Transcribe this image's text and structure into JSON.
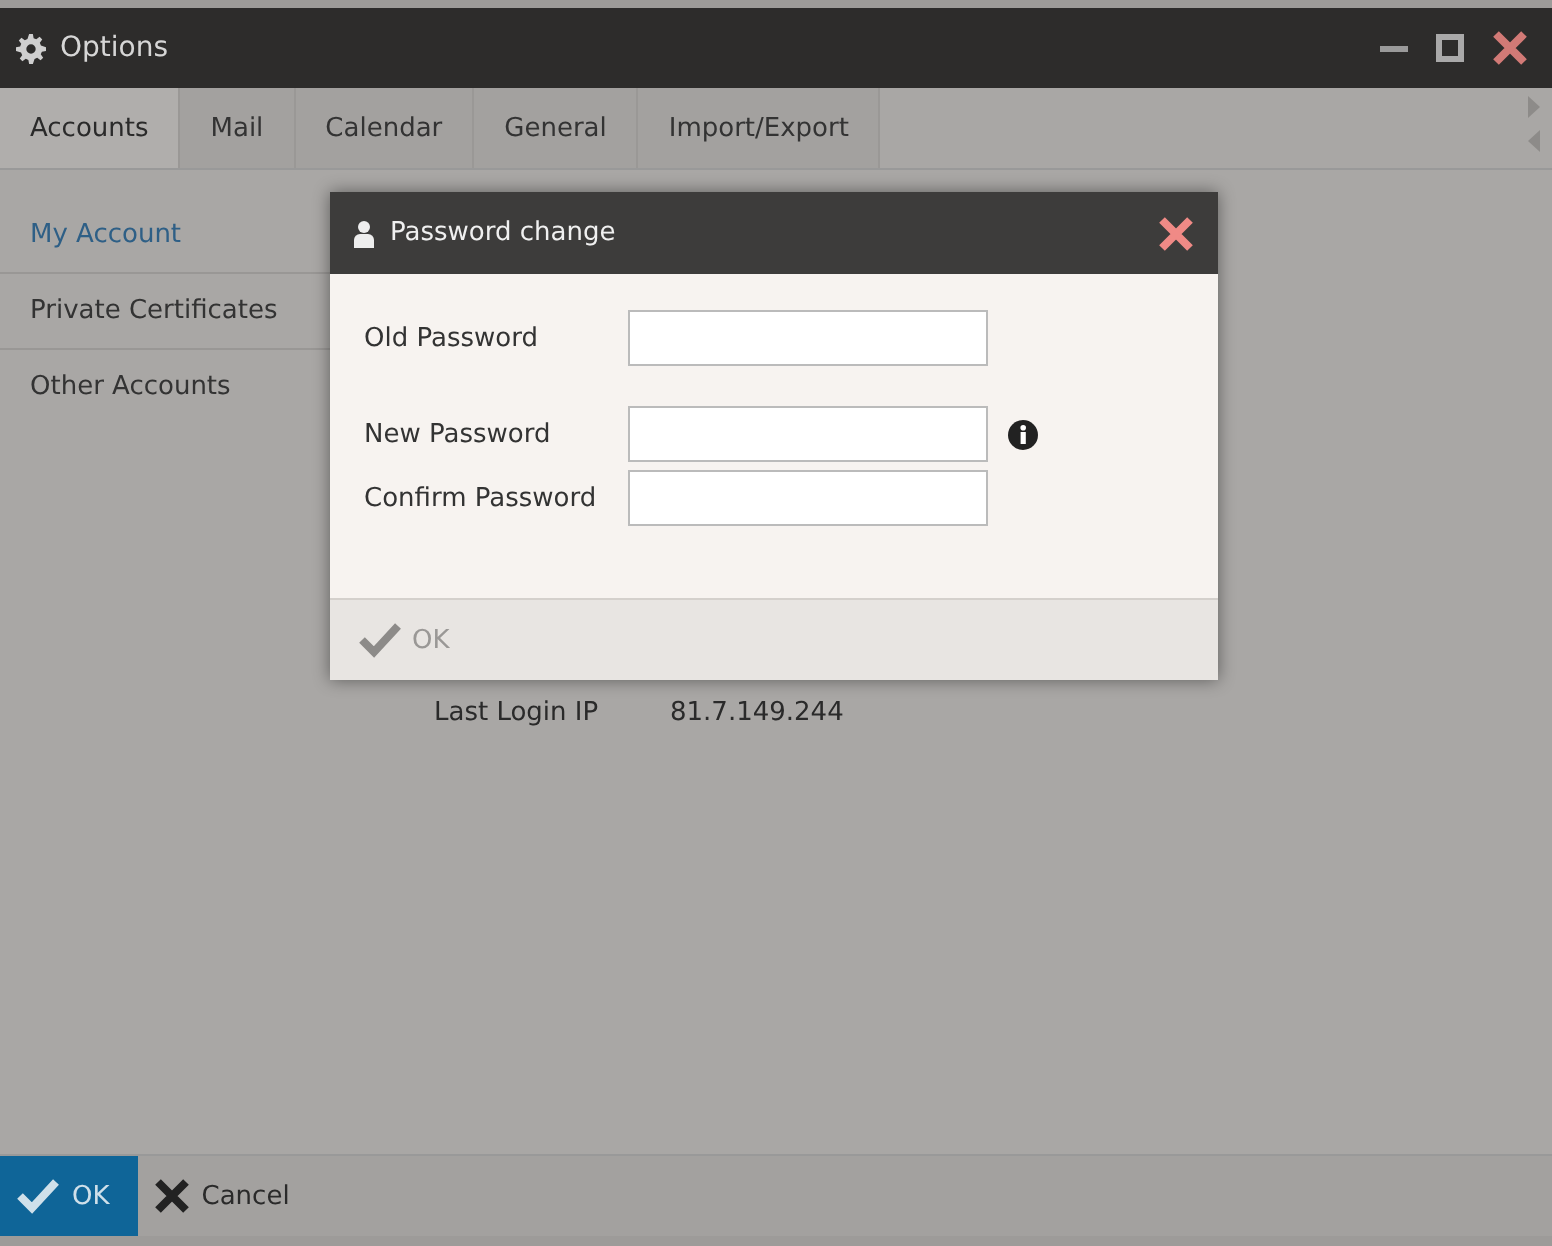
{
  "window": {
    "title": "Options"
  },
  "tabs": [
    {
      "label": "Accounts",
      "selected": true
    },
    {
      "label": "Mail",
      "selected": false
    },
    {
      "label": "Calendar",
      "selected": false
    },
    {
      "label": "General",
      "selected": false
    },
    {
      "label": "Import/Export",
      "selected": false
    }
  ],
  "sidebar": {
    "items": [
      {
        "label": "My Account",
        "selected": true
      },
      {
        "label": "Private Certificates",
        "selected": false
      },
      {
        "label": "Other Accounts",
        "selected": false
      }
    ]
  },
  "account_info": [
    {
      "label": "Last Login IP",
      "value": "81.7.149.244"
    }
  ],
  "footer": {
    "buttons": [
      {
        "label": "OK",
        "kind": "primary"
      },
      {
        "label": "Cancel",
        "kind": "cancel"
      }
    ]
  },
  "dialog": {
    "title": "Password change",
    "fields": [
      {
        "label": "Old Password"
      },
      {
        "label": "New Password",
        "info": true
      },
      {
        "label": "Confirm Password"
      }
    ],
    "ok_button": {
      "label": "OK",
      "disabled": true
    }
  }
}
